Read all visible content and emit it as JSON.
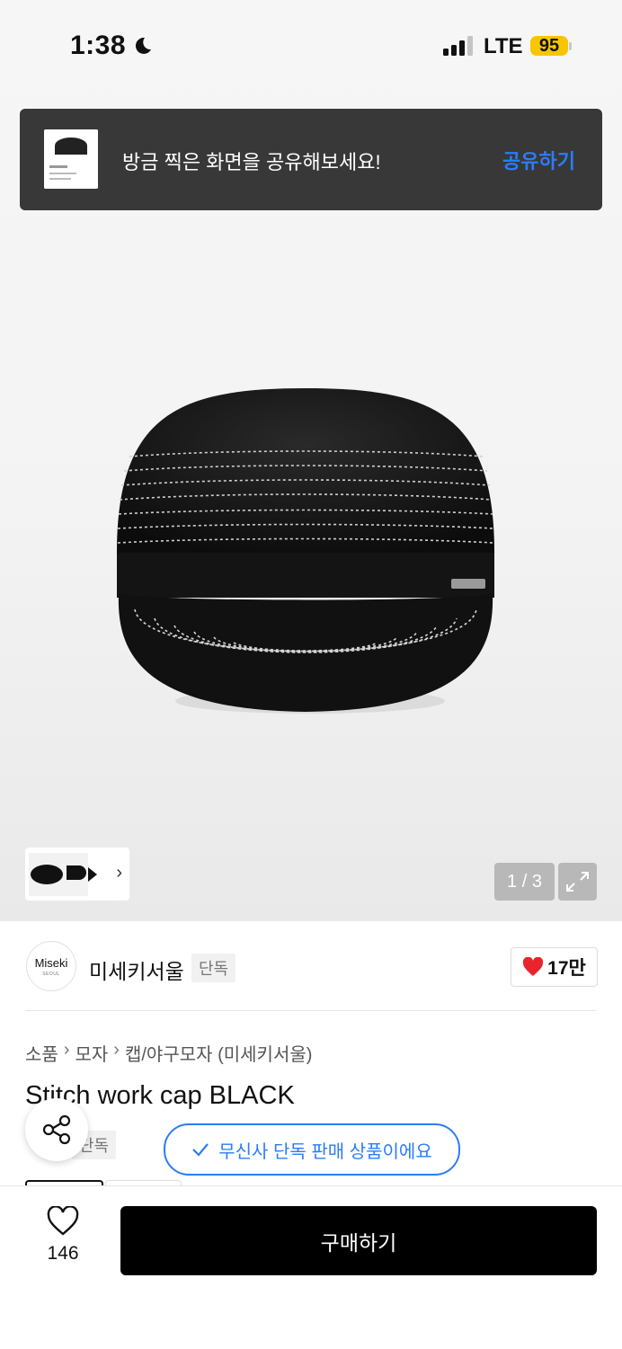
{
  "status_bar": {
    "time": "1:38",
    "network": "LTE",
    "battery": "95"
  },
  "share_banner": {
    "message": "방금 찍은 화면을 공유해보세요!",
    "action": "공유하기"
  },
  "gallery": {
    "counter": "1 / 3"
  },
  "brand": {
    "logo_text": "Miseki",
    "logo_sub": "SEOUL",
    "name": "미세키서울",
    "tag": "단독",
    "likes": "17만"
  },
  "breadcrumb": [
    "소품",
    "모자",
    "캡/야구모자 (미세키서울)"
  ],
  "product": {
    "title": "Stitch work cap BLACK",
    "tag": "단독",
    "exclusive_notice": "무신사 단독 판매 상품이에요"
  },
  "bottom_bar": {
    "like_count": "146",
    "buy_label": "구매하기"
  },
  "colors": {
    "accent_blue": "#2c7cf6",
    "heart_red": "#e8242c",
    "banner_bg": "#383838",
    "battery": "#f7c600"
  }
}
